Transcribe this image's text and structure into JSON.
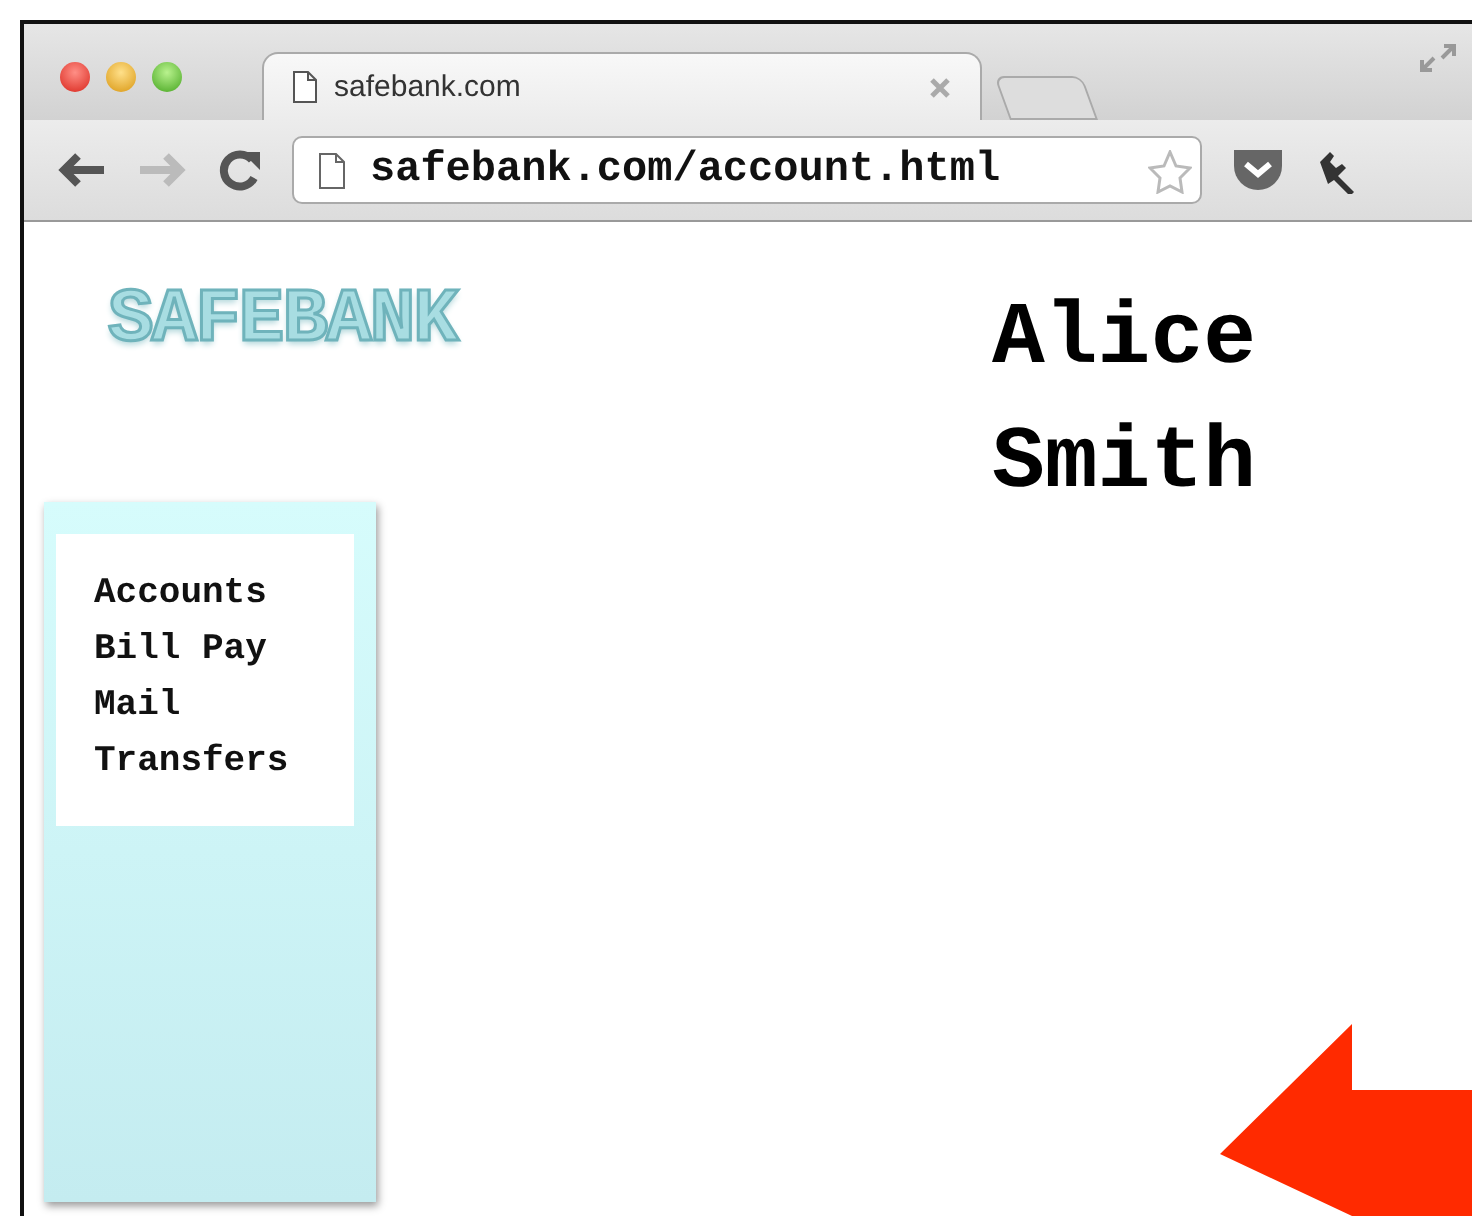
{
  "browser": {
    "tab_title": "safebank.com",
    "url": "safebank.com/account.html"
  },
  "page": {
    "logo": "SAFEBANK",
    "user_name": "Alice Smith",
    "nav": [
      {
        "label": "Accounts"
      },
      {
        "label": "Bill Pay"
      },
      {
        "label": "Mail"
      },
      {
        "label": "Transfers"
      }
    ]
  }
}
